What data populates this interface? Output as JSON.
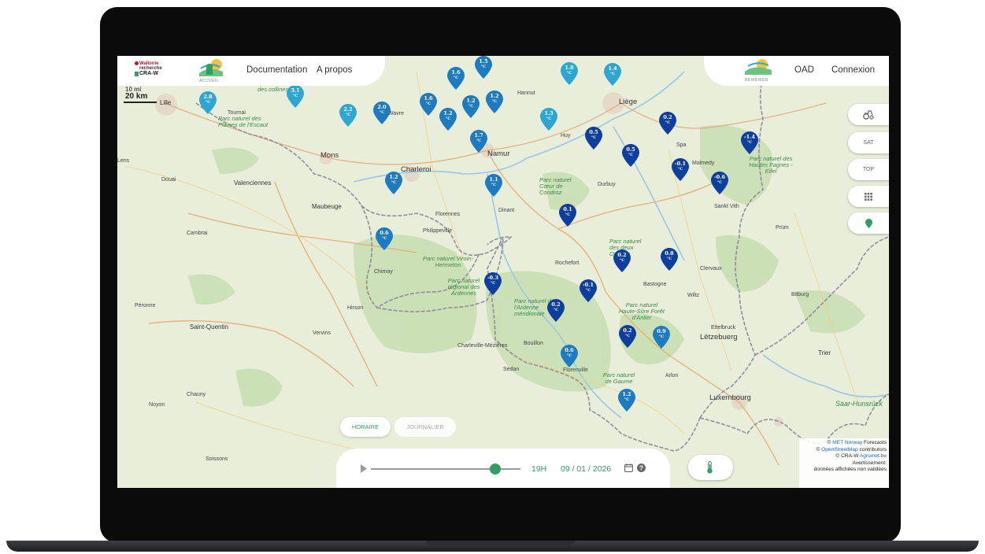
{
  "nav": {
    "logo_line1": "Wallonie",
    "logo_line2": "recherche",
    "logo_line3": "CRA-W",
    "home_caption": "ACCUEIL",
    "documentation": "Documentation",
    "apropos": "A propos",
    "right_logo_caption": "BEWEWER",
    "oad": "OAD",
    "connexion": "Connexion"
  },
  "scale": {
    "mi": "10 mi",
    "km": "20 km"
  },
  "side_buttons": {
    "sat": "SAT",
    "top": "TOP"
  },
  "modes": {
    "hourly": "HORAIRE",
    "daily": "JOURNALIER"
  },
  "timebar": {
    "hour": "19H",
    "date": "09 / 01 / 2026",
    "progress": 0.83
  },
  "attribution": {
    "line1_link": "MET Norway",
    "line1_rest": " Forecasts",
    "line2_link": "OpenStreetMap",
    "line2_rest": " contributors",
    "line3_prefix": "© CRA-W ",
    "line3_link": "Agromet.be",
    "line4": "Avertissement:",
    "line5": "données affichées non validées",
    "copy": "© "
  },
  "unit": "°C",
  "colors": {
    "accent": "#2f9e62",
    "pin_light": "#2fa6cf",
    "pin_mid": "#1f7bc0",
    "pin_dark": "#0f3f9c"
  },
  "stations": [
    {
      "value": "1.5",
      "shade": "mid"
    },
    {
      "value": "1.6",
      "shade": "mid"
    },
    {
      "value": "1.8",
      "shade": "light"
    },
    {
      "value": "1.4",
      "shade": "light"
    },
    {
      "value": "3.1",
      "shade": "light"
    },
    {
      "value": "2.8",
      "shade": "light"
    },
    {
      "value": "2.2",
      "shade": "light"
    },
    {
      "value": "2.0",
      "shade": "mid"
    },
    {
      "value": "1.6",
      "shade": "mid"
    },
    {
      "value": "1.2",
      "shade": "mid"
    },
    {
      "value": "1.2",
      "shade": "mid"
    },
    {
      "value": "1.2",
      "shade": "mid"
    },
    {
      "value": "1.3",
      "shade": "light"
    },
    {
      "value": "0.2",
      "shade": "dark"
    },
    {
      "value": "-1.4",
      "shade": "dark"
    },
    {
      "value": "1.7",
      "shade": "mid"
    },
    {
      "value": "0.5",
      "shade": "dark"
    },
    {
      "value": "0.5",
      "shade": "dark"
    },
    {
      "value": "-0.1",
      "shade": "dark"
    },
    {
      "value": "-0.6",
      "shade": "dark"
    },
    {
      "value": "1.2",
      "shade": "mid"
    },
    {
      "value": "1.1",
      "shade": "mid"
    },
    {
      "value": "0.1",
      "shade": "dark"
    },
    {
      "value": "0.6",
      "shade": "mid"
    },
    {
      "value": "0.2",
      "shade": "dark"
    },
    {
      "value": "0.8",
      "shade": "dark"
    },
    {
      "value": "-0.3",
      "shade": "dark"
    },
    {
      "value": "-0.1",
      "shade": "dark"
    },
    {
      "value": "0.2",
      "shade": "dark"
    },
    {
      "value": "0.2",
      "shade": "dark"
    },
    {
      "value": "0.9",
      "shade": "mid"
    },
    {
      "value": "0.6",
      "shade": "mid"
    },
    {
      "value": "1.2",
      "shade": "mid"
    }
  ],
  "map_labels": {
    "lille": "Lille",
    "tournai": "Tournai",
    "mons": "Mons",
    "charleroi": "Charleroi",
    "namur": "Namur",
    "liege": "Liège",
    "maubeuge": "Maubeuge",
    "valenciennes": "Valenciennes",
    "cambrai": "Cambrai",
    "douai": "Douai",
    "lens": "Lens",
    "saint_quentin": "Saint-Quentin",
    "chimay": "Chimay",
    "dinant": "Dinant",
    "rochefort": "Rochefort",
    "charleville": "Charleville-Mézières",
    "sedan": "Sedan",
    "bastogne": "Bastogne",
    "arlon": "Arlon",
    "letzebuerg": "Lëtzebuerg",
    "luxembourg": "Luxembourg",
    "trier": "Trier",
    "wavre": "Wavre",
    "hannut": "Hannut",
    "huy": "Huy",
    "spa": "Spa",
    "malmedy": "Malmedy",
    "saint_vith": "Sankt Vith",
    "durbuy": "Durbuy",
    "florenne": "Florennes",
    "philippeville": "Philippeville",
    "hirson": "Hirson",
    "vervins": "Vervins",
    "peronne": "Péronne",
    "soissons": "Soissons",
    "noyon": "Noyon",
    "chauny": "Chauny",
    "bouillon": "Bouillon",
    "florenville": "Florenville",
    "clervaux": "Clervaux",
    "wiltz": "Wiltz",
    "ettelbruck": "Ettelbruck",
    "prum": "Prüm",
    "bitburg": "Bitburg",
    "park_escaut": "Parc naturel des Plaines de l'Escaut",
    "park_ardennes": "Parc naturel régional des Ardennes",
    "park_viroin": "Parc naturel Viroin-Hermeton",
    "park_fagnes": "Parc naturel des Hautes Fagnes - Eifel",
    "park_condroz": "Parc naturel Cœur de Condroz",
    "park_sure": "Parc naturel Haute-Sûre Forêt d'Anlier",
    "park_collines": "des collines",
    "park_meridionale": "Parc naturel de l'Ardenne méridionale",
    "park_gaume": "Parc naturel de Gaume",
    "park_ourthe": "Parc naturel des deux Ourthes",
    "saar": "Saar-Hunsrück"
  }
}
